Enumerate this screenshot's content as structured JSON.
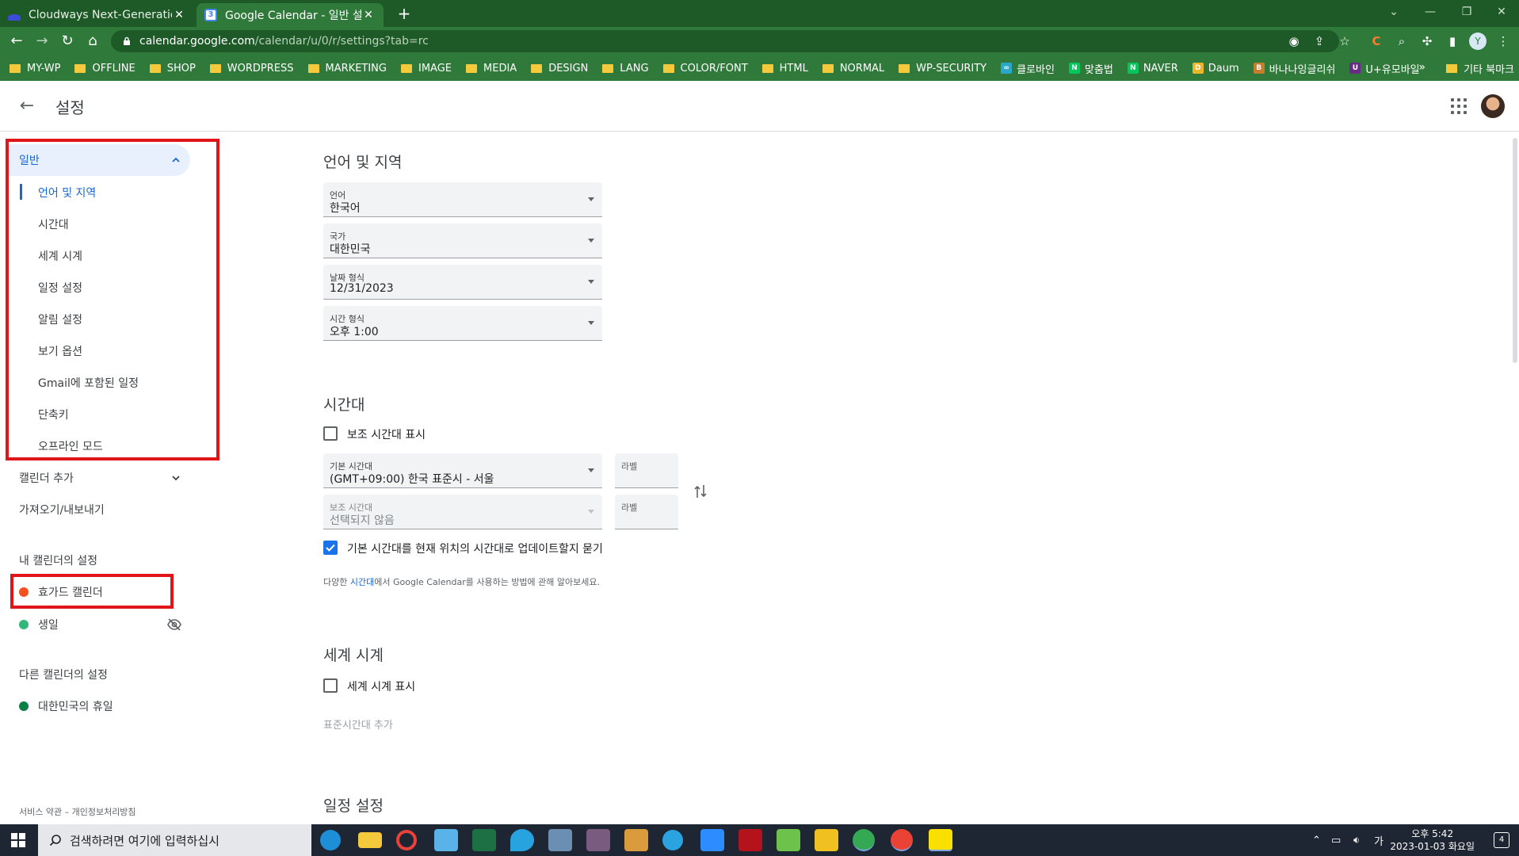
{
  "browser": {
    "tabs": [
      {
        "title": "Cloudways Next-Generation Clo",
        "favicon_color": "#3b4dd8"
      },
      {
        "title": "Google Calendar - 일반 설정",
        "favicon_color": "#4285f4",
        "favicon_text": "3"
      }
    ],
    "new_tab_symbol": "+",
    "url_host": "calendar.google.com",
    "url_path": "/calendar/u/0/r/settings?tab=rc",
    "bookmarks": [
      {
        "label": "MY-WP",
        "type": "folder"
      },
      {
        "label": "OFFLINE",
        "type": "folder"
      },
      {
        "label": "SHOP",
        "type": "folder"
      },
      {
        "label": "WORDPRESS",
        "type": "folder"
      },
      {
        "label": "MARKETING",
        "type": "folder"
      },
      {
        "label": "IMAGE",
        "type": "folder"
      },
      {
        "label": "MEDIA",
        "type": "folder"
      },
      {
        "label": "DESIGN",
        "type": "folder"
      },
      {
        "label": "LANG",
        "type": "folder"
      },
      {
        "label": "COLOR/FONT",
        "type": "folder"
      },
      {
        "label": "HTML",
        "type": "folder"
      },
      {
        "label": "NORMAL",
        "type": "folder"
      },
      {
        "label": "WP-SECURITY",
        "type": "folder"
      },
      {
        "label": "클로바인",
        "type": "site",
        "color": "#2aa8c9",
        "glyph": "∞"
      },
      {
        "label": "맞춤법",
        "type": "site",
        "color": "#03c75a",
        "glyph": "N"
      },
      {
        "label": "NAVER",
        "type": "site",
        "color": "#03c75a",
        "glyph": "N"
      },
      {
        "label": "Daum",
        "type": "site",
        "color": "#f0b429",
        "glyph": "D"
      },
      {
        "label": "바나나잉글리쉬",
        "type": "site",
        "color": "#c77d2a",
        "glyph": "B"
      },
      {
        "label": "U+유모바일",
        "type": "site",
        "color": "#6a2b86",
        "glyph": "U"
      }
    ],
    "bookmarks_more": "»",
    "other_bookmarks": "기타 북마크"
  },
  "app": {
    "title": "설정"
  },
  "sidebar": {
    "general": "일반",
    "general_items": [
      "언어 및 지역",
      "시간대",
      "세계 시계",
      "일정 설정",
      "알림 설정",
      "보기 옵션",
      "Gmail에 포함된 일정",
      "단축키",
      "오프라인 모드"
    ],
    "add_calendar": "캘린더 추가",
    "import_export": "가져오기/내보내기",
    "my_calendars_header": "내 캘린더의 설정",
    "my_calendars": [
      {
        "name": "효가드 캘린더",
        "color": "#f4511e"
      },
      {
        "name": "생일",
        "color": "#33b679"
      }
    ],
    "other_calendars_header": "다른 캘린더의 설정",
    "other_calendars": [
      {
        "name": "대한민국의 휴일",
        "color": "#0b8043"
      }
    ],
    "footer": "서비스 약관 – 개인정보처리방침"
  },
  "main": {
    "lang_region": {
      "heading": "언어 및 지역",
      "fields": [
        {
          "label": "언어",
          "value": "한국어"
        },
        {
          "label": "국가",
          "value": "대한민국"
        },
        {
          "label": "날짜 형식",
          "value": "12/31/2023"
        },
        {
          "label": "시간 형식",
          "value": "오후 1:00"
        }
      ]
    },
    "timezone": {
      "heading": "시간대",
      "show_secondary": "보조 시간대 표시",
      "show_secondary_checked": false,
      "primary_label": "기본 시간대",
      "primary_value": "(GMT+09:00) 한국 표준시 - 서울",
      "secondary_label": "보조 시간대",
      "secondary_value": "선택되지 않음",
      "label_placeholder": "라벨",
      "ask_update": "기본 시간대를 현재 위치의 시간대로 업데이트할지 묻기",
      "ask_update_checked": true,
      "note_prefix": "다양한 ",
      "note_link": "시간대",
      "note_suffix": "에서 Google Calendar를 사용하는 방법에 관해 알아보세요."
    },
    "world_clock": {
      "heading": "세계 시계",
      "show": "세계 시계 표시",
      "show_checked": false,
      "add_tz": "표준시간대 추가"
    },
    "event_settings": {
      "heading": "일정 설정"
    }
  },
  "taskbar": {
    "search_placeholder": "검색하려면 여기에 입력하십시",
    "ime": "가",
    "time": "오후 5:42",
    "date": "2023-01-03 화요일",
    "notifications": "4"
  },
  "colors": {
    "chrome_dark": "#1e5a27",
    "chrome": "#2f7a3a",
    "accent": "#1a73e8",
    "highlight_red": "#e0151a"
  }
}
